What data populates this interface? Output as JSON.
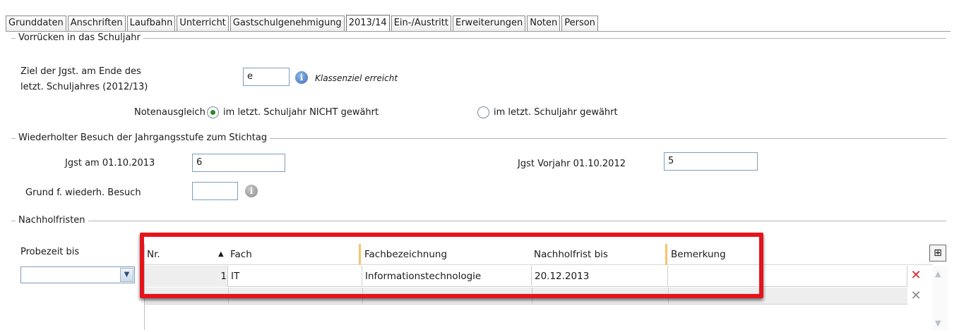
{
  "tabs": [
    "Grunddaten",
    "Anschriften",
    "Laufbahn",
    "Unterricht",
    "Gastschulgenehmigung",
    "2013/14",
    "Ein-/Austritt",
    "Erweiterungen",
    "Noten",
    "Person"
  ],
  "active_tab": "2013/14",
  "sections": {
    "vorruecken": "Vorrücken in das Schuljahr",
    "wiederholter": "Wiederholter Besuch der Jahrgangsstufe zum Stichtag",
    "nachholfristen": "Nachholfristen"
  },
  "ziel": {
    "label_line1": "Ziel der Jgst. am Ende des",
    "label_line2": "letzt. Schuljahres (2012/13)",
    "value": "e",
    "info_text": "Klassenziel erreicht"
  },
  "notenausgleich": {
    "label": "Notenausgleich",
    "option1": "im letzt. Schuljahr NICHT gewährt",
    "option2": "im letzt. Schuljahr gewährt",
    "selected": "option1"
  },
  "jgst": {
    "label": "Jgst am 01.10.2013",
    "value": "6",
    "vorjahr_label": "Jgst Vorjahr 01.10.2012",
    "vorjahr_value": "5",
    "grund_label": "Grund f. wiederh. Besuch",
    "grund_value": ""
  },
  "probezeit": {
    "label": "Probezeit bis",
    "value": ""
  },
  "grid": {
    "columns": [
      "Nr.",
      "Fach",
      "Fachbezeichnung",
      "Nachholfrist bis",
      "Bemerkung"
    ],
    "rows": [
      {
        "nr": "1",
        "fach": "IT",
        "fachbezeichnung": "Informationstechnologie",
        "nachholfrist": "20.12.2013",
        "bemerkung": ""
      }
    ]
  },
  "colors": {
    "highlight": "#e5141b",
    "delete_active": "#d9262b",
    "delete_inactive": "#8a8a8a",
    "radio_selected": "#2a8a2a"
  }
}
